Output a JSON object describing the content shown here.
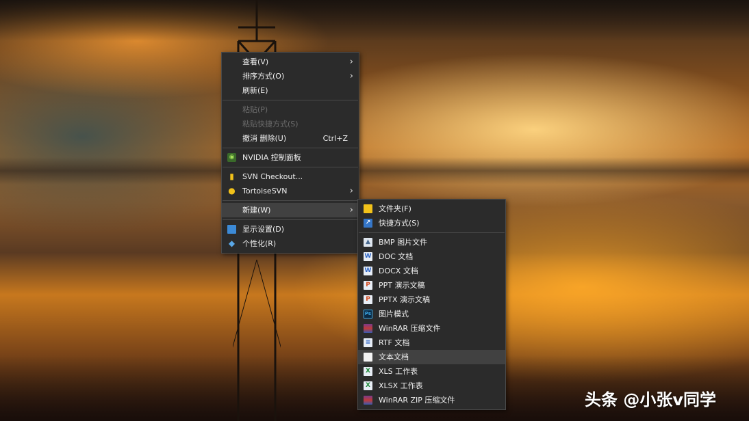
{
  "context_menu": {
    "items": [
      {
        "label": "查看(V)",
        "has_submenu": true
      },
      {
        "label": "排序方式(O)",
        "has_submenu": true
      },
      {
        "label": "刷新(E)"
      },
      {
        "label": "粘贴(P)",
        "disabled": true
      },
      {
        "label": "粘贴快捷方式(S)",
        "disabled": true
      },
      {
        "label": "撤消 删除(U)",
        "shortcut": "Ctrl+Z"
      },
      {
        "label": "NVIDIA 控制面板",
        "icon": "nvidia-icon"
      },
      {
        "label": "SVN Checkout...",
        "icon": "svn-icon"
      },
      {
        "label": "TortoiseSVN",
        "icon": "tortoise-icon",
        "has_submenu": true
      },
      {
        "label": "新建(W)",
        "has_submenu": true,
        "highlighted": true
      },
      {
        "label": "显示设置(D)",
        "icon": "monitor-icon"
      },
      {
        "label": "个性化(R)",
        "icon": "personalize-icon"
      }
    ]
  },
  "new_submenu": {
    "items": [
      {
        "label": "文件夹(F)",
        "icon": "folder-icon"
      },
      {
        "label": "快捷方式(S)",
        "icon": "shortcut-icon"
      },
      {
        "label": "BMP 图片文件",
        "icon": "bmp-icon"
      },
      {
        "label": "DOC 文档",
        "icon": "doc-icon"
      },
      {
        "label": "DOCX 文档",
        "icon": "docx-icon"
      },
      {
        "label": "PPT 演示文稿",
        "icon": "ppt-icon"
      },
      {
        "label": "PPTX 演示文稿",
        "icon": "pptx-icon"
      },
      {
        "label": "图片模式",
        "icon": "photoshop-icon"
      },
      {
        "label": "WinRAR 压缩文件",
        "icon": "winrar-icon"
      },
      {
        "label": "RTF 文档",
        "icon": "rtf-icon"
      },
      {
        "label": "文本文档",
        "icon": "text-icon",
        "highlighted": true
      },
      {
        "label": "XLS 工作表",
        "icon": "xls-icon"
      },
      {
        "label": "XLSX 工作表",
        "icon": "xlsx-icon"
      },
      {
        "label": "WinRAR ZIP 压缩文件",
        "icon": "winrar-zip-icon"
      }
    ]
  },
  "watermark": "头条 @小张v同学",
  "colors": {
    "menu_bg": "#2b2b2b",
    "menu_border": "#4a4a4a",
    "highlight": "#414141",
    "disabled_text": "#6d6d6d"
  }
}
